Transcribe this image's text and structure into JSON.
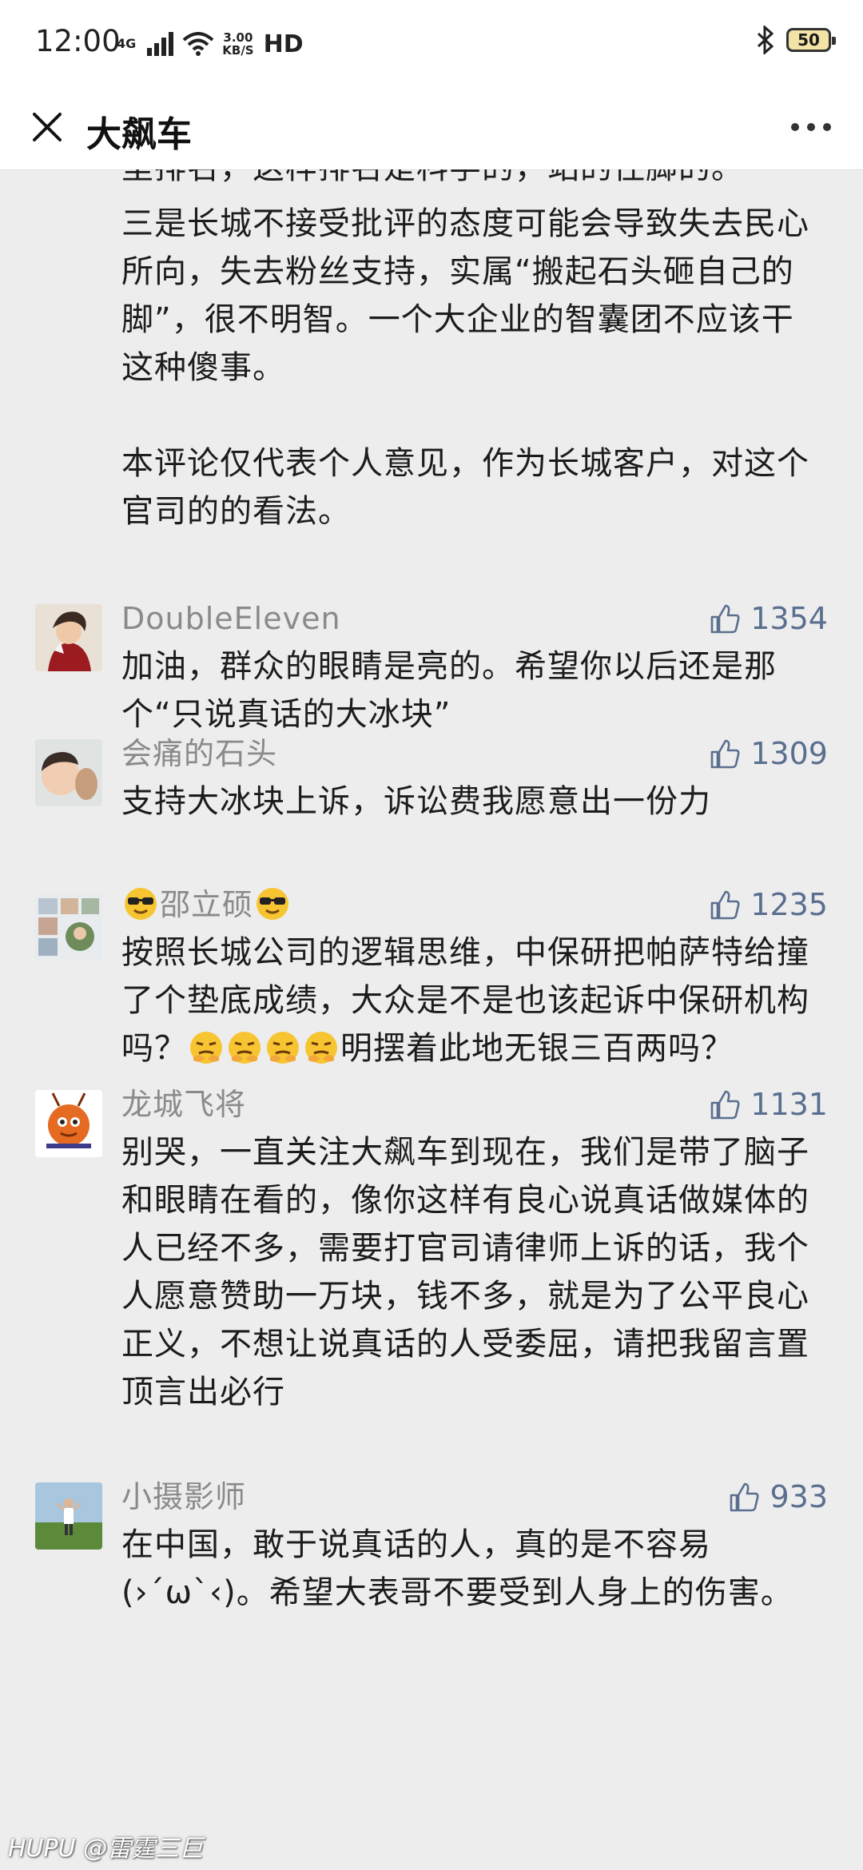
{
  "status_bar": {
    "time": "12:00",
    "network": "4G",
    "speed_top": "3.00",
    "speed_bottom": "KB/S",
    "hd": "HD",
    "battery": "50"
  },
  "header": {
    "title": "大飙车"
  },
  "intro_cut_line": "里排名，这样排名是科学的，站的住脚的。",
  "intro_paragraph_1": "三是长城不接受批评的态度可能会导致失去民心所向，失去粉丝支持，实属“搬起石头砸自己的脚”，很不明智。一个大企业的智囊团不应该干这种傻事。",
  "intro_paragraph_2": "本评论仅代表个人意见，作为长城客户，对这个官司的的看法。",
  "comments": [
    {
      "user": "DoubleEleven",
      "likes": "1354",
      "text": "加油，群众的眼睛是亮的。希望你以后还是那个“只说真话的大冰块”"
    },
    {
      "user": "会痛的石头",
      "likes": "1309",
      "text": "支持大冰块上诉，诉讼费我愿意出一份力"
    },
    {
      "user": "邵立硕",
      "likes": "1235",
      "text_before": "按照长城公司的逻辑思维，中保研把帕萨特给撞了个垫底成绩，大众是不是也该起诉中保研机构吗？",
      "text_after": "明摆着此地无银三百两吗？"
    },
    {
      "user": "龙城飞将",
      "likes": "1131",
      "text": "别哭，一直关注大飙车到现在，我们是带了脑子和眼睛在看的，像你这样有良心说真话做媒体的人已经不多，需要打官司请律师上诉的话，我个人愿意赞助一万块，钱不多，就是为了公平良心正义，不想让说真话的人受委屈，请把我留言置顶言出必行"
    },
    {
      "user": "小摄影师",
      "likes": "933",
      "text": "在中国，敢于说真话的人，真的是不容易(›´ω`‹)。希望大表哥不要受到人身上的伤害。"
    }
  ],
  "watermark": "HUPU @雷霆三巨",
  "colors": {
    "background": "#ededed",
    "name_gray": "#8a8a8a",
    "like_blue": "#5a6f8f"
  }
}
